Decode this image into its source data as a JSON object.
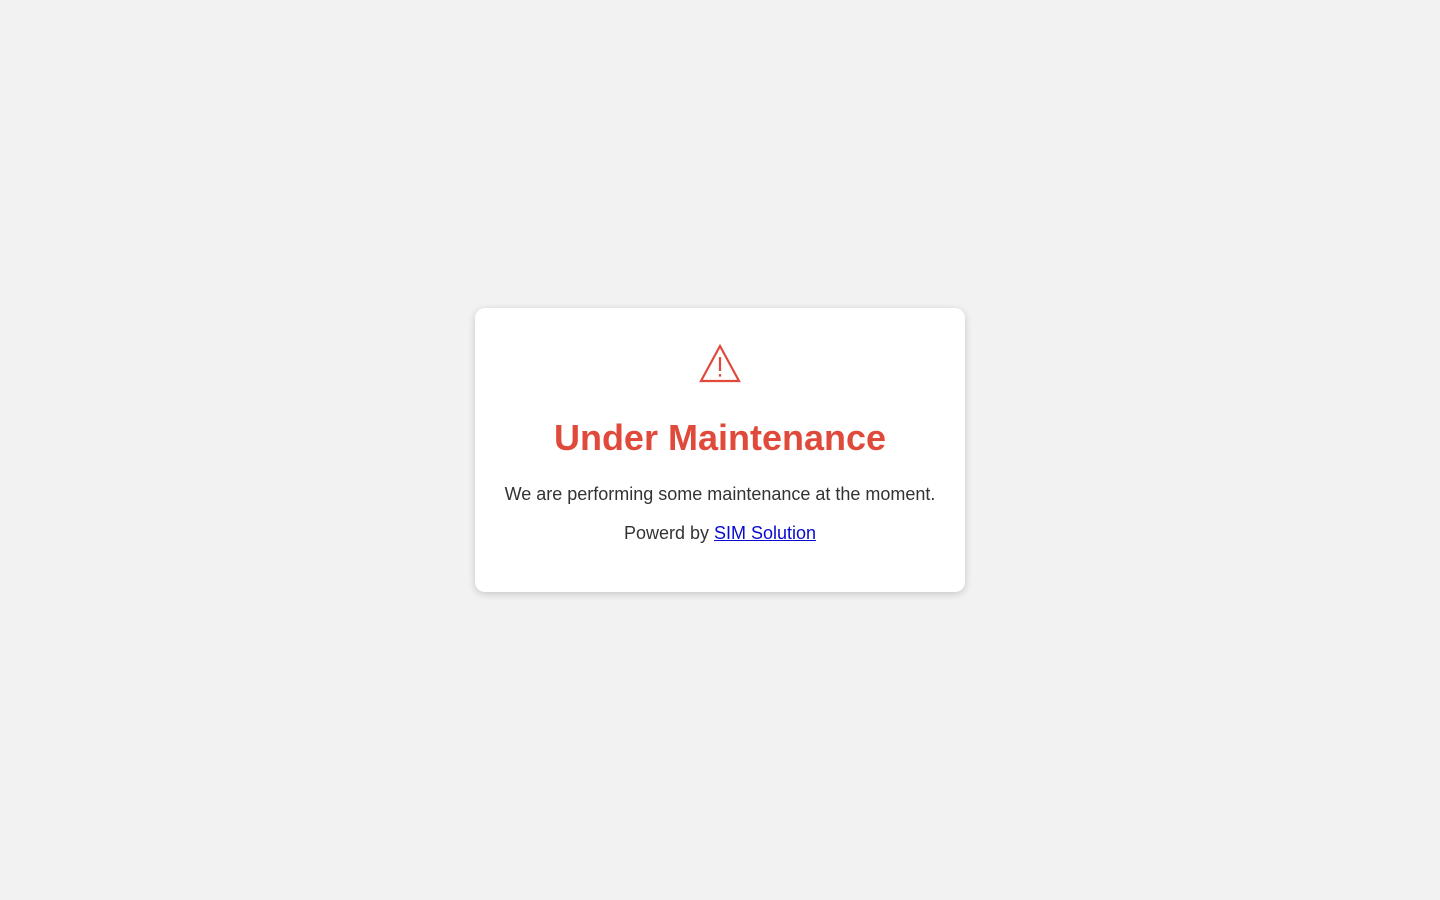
{
  "icon": "warning-triangle-icon",
  "colors": {
    "background": "#f2f2f2",
    "card": "#ffffff",
    "accent": "#e04a3b",
    "text": "#333333",
    "link": "#0a0ad0"
  },
  "maintenance": {
    "title": "Under Maintenance",
    "message": "We are performing some maintenance at the moment.",
    "powered_prefix": "Powerd by",
    "powered_link": "SIM Solution"
  }
}
